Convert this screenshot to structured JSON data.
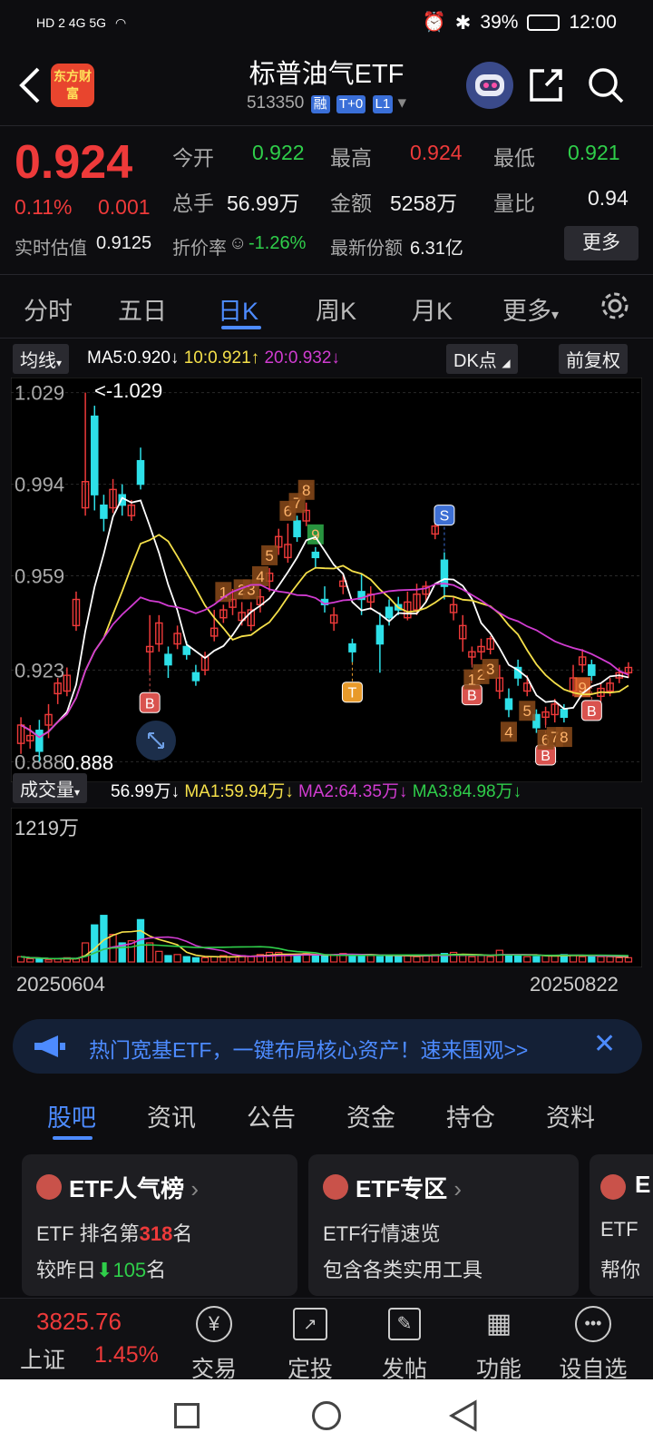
{
  "status": {
    "net": "HD 2 4G 5G",
    "battery": "39%",
    "time": "12:00"
  },
  "header": {
    "logo": "东方财富",
    "title": "标普油气ETF",
    "code": "513350",
    "tags": [
      "融",
      "T+0",
      "L1"
    ]
  },
  "quote": {
    "price": "0.924",
    "pct": "0.11%",
    "chg": "0.001",
    "open_label": "今开",
    "open": "0.922",
    "high_label": "最高",
    "high": "0.924",
    "low_label": "最低",
    "low": "0.921",
    "vol_label": "总手",
    "vol": "56.99万",
    "amt_label": "金额",
    "amt": "5258万",
    "ratio_label": "量比",
    "ratio": "0.94",
    "est_label": "实时估值",
    "est": "0.9125",
    "discount_label": "折价率",
    "discount": "-1.26%",
    "shares_label": "最新份额",
    "shares": "6.31亿",
    "more": "更多"
  },
  "tabs": [
    "分时",
    "五日",
    "日K",
    "周K",
    "月K",
    "更多"
  ],
  "active_tab": "日K",
  "kline": {
    "ma_mode": "均线",
    "ma5": "MA5:0.920",
    "ma10": "10:0.921",
    "ma20": "20:0.932",
    "dk": "DK点",
    "adjust": "前复权",
    "max_marker": "<-1.029",
    "min_marker": "0.888",
    "vol_mode": "成交量",
    "vol_now": "56.99万",
    "ma1": "MA1:59.94万",
    "ma2": "MA2:64.35万",
    "ma3": "MA3:84.98万",
    "vol_max": "1219万",
    "date_start": "20250604",
    "date_end": "20250822"
  },
  "chart_data": {
    "type": "candlestick",
    "price_axis": [
      1.029,
      0.994,
      0.959,
      0.923,
      0.888
    ],
    "ylim": [
      0.885,
      1.032
    ],
    "candles": [
      [
        0.895,
        0.902,
        0.905,
        0.891
      ],
      [
        0.896,
        0.898,
        0.902,
        0.893
      ],
      [
        0.9,
        0.892,
        0.904,
        0.888
      ],
      [
        0.902,
        0.906,
        0.91,
        0.897
      ],
      [
        0.914,
        0.918,
        0.92,
        0.91
      ],
      [
        0.915,
        0.921,
        0.924,
        0.913
      ],
      [
        0.94,
        0.95,
        0.953,
        0.938
      ],
      [
        0.985,
        0.995,
        1.029,
        0.982
      ],
      [
        1.02,
        0.99,
        1.024,
        0.984
      ],
      [
        0.986,
        0.981,
        0.99,
        0.976
      ],
      [
        0.985,
        0.992,
        0.996,
        0.983
      ],
      [
        0.99,
        0.986,
        0.994,
        0.982
      ],
      [
        0.982,
        0.986,
        0.988,
        0.98
      ],
      [
        1.003,
        0.994,
        1.008,
        0.992
      ],
      [
        0.93,
        0.932,
        0.944,
        0.922
      ],
      [
        0.933,
        0.941,
        0.944,
        0.93
      ],
      [
        0.929,
        0.925,
        0.932,
        0.92
      ],
      [
        0.933,
        0.937,
        0.94,
        0.931
      ],
      [
        0.932,
        0.929,
        0.934,
        0.927
      ],
      [
        0.922,
        0.919,
        0.925,
        0.917
      ],
      [
        0.923,
        0.928,
        0.93,
        0.921
      ],
      [
        0.936,
        0.939,
        0.946,
        0.934
      ],
      [
        0.943,
        0.946,
        0.948,
        0.941
      ],
      [
        0.947,
        0.95,
        0.954,
        0.944
      ],
      [
        0.942,
        0.945,
        0.949,
        0.94
      ],
      [
        0.94,
        0.946,
        0.949,
        0.938
      ],
      [
        0.948,
        0.951,
        0.954,
        0.945
      ],
      [
        0.957,
        0.96,
        0.962,
        0.953
      ],
      [
        0.97,
        0.974,
        0.977,
        0.967
      ],
      [
        0.966,
        0.971,
        0.979,
        0.964
      ],
      [
        0.98,
        0.974,
        0.982,
        0.972
      ],
      [
        0.98,
        0.984,
        0.987,
        0.978
      ],
      [
        0.968,
        0.966,
        0.97,
        0.962
      ],
      [
        0.95,
        0.948,
        0.955,
        0.945
      ],
      [
        0.941,
        0.944,
        0.947,
        0.938
      ],
      [
        0.955,
        0.957,
        0.96,
        0.952
      ],
      [
        0.933,
        0.93,
        0.935,
        0.926
      ],
      [
        0.953,
        0.95,
        0.96,
        0.944
      ],
      [
        0.949,
        0.952,
        0.955,
        0.946
      ],
      [
        0.94,
        0.933,
        0.945,
        0.922
      ],
      [
        0.947,
        0.943,
        0.95,
        0.94
      ],
      [
        0.948,
        0.946,
        0.951,
        0.944
      ],
      [
        0.943,
        0.949,
        0.953,
        0.942
      ],
      [
        0.946,
        0.952,
        0.956,
        0.944
      ],
      [
        0.952,
        0.955,
        0.957,
        0.949
      ],
      [
        0.975,
        0.978,
        0.981,
        0.973
      ],
      [
        0.965,
        0.955,
        0.968,
        0.95
      ],
      [
        0.945,
        0.948,
        0.951,
        0.942
      ],
      [
        0.935,
        0.94,
        0.944,
        0.93
      ],
      [
        0.928,
        0.93,
        0.932,
        0.925
      ],
      [
        0.93,
        0.932,
        0.935,
        0.927
      ],
      [
        0.931,
        0.935,
        0.936,
        0.929
      ],
      [
        0.915,
        0.92,
        0.925,
        0.912
      ],
      [
        0.912,
        0.908,
        0.916,
        0.905
      ],
      [
        0.924,
        0.92,
        0.927,
        0.917
      ],
      [
        0.915,
        0.918,
        0.921,
        0.913
      ],
      [
        0.906,
        0.901,
        0.908,
        0.899
      ],
      [
        0.905,
        0.907,
        0.909,
        0.902
      ],
      [
        0.906,
        0.91,
        0.912,
        0.903
      ],
      [
        0.908,
        0.905,
        0.91,
        0.903
      ],
      [
        0.915,
        0.92,
        0.925,
        0.913
      ],
      [
        0.925,
        0.928,
        0.931,
        0.922
      ],
      [
        0.925,
        0.921,
        0.927,
        0.919
      ],
      [
        0.913,
        0.916,
        0.918,
        0.911
      ],
      [
        0.915,
        0.918,
        0.92,
        0.913
      ],
      [
        0.92,
        0.922,
        0.924,
        0.918
      ],
      [
        0.922,
        0.924,
        0.926,
        0.92
      ]
    ],
    "dk_labels": [
      "B",
      "B",
      "T",
      "S",
      "B",
      "B"
    ],
    "seq_labels": [
      "1",
      "2",
      "3",
      "4",
      "5",
      "6",
      "7",
      "8",
      "9",
      "1",
      "2",
      "3",
      "4",
      "5",
      "6",
      "7",
      "8",
      "9"
    ],
    "volumes": [
      5,
      3,
      3,
      2,
      3,
      4,
      3,
      18,
      35,
      44,
      26,
      18,
      20,
      40,
      18,
      10,
      6,
      7,
      5,
      4,
      4,
      5,
      6,
      5,
      6,
      5,
      7,
      9,
      9,
      6,
      6,
      8,
      6,
      6,
      7,
      8,
      7,
      7,
      6,
      5,
      6,
      6,
      6,
      5,
      6,
      7,
      8,
      9,
      6,
      5,
      6,
      5,
      11,
      7,
      6,
      5,
      5,
      6,
      6,
      7,
      6,
      5,
      6,
      5,
      5,
      4,
      4
    ],
    "vol_ylim": [
      0,
      120
    ]
  },
  "banner": {
    "text": "热门宽基ETF，一键布局核心资产！速来围观>>"
  },
  "bottom_tabs": [
    "股吧",
    "资讯",
    "公告",
    "资金",
    "持仓",
    "资料"
  ],
  "active_bottom_tab": "股吧",
  "cards": [
    {
      "title": "ETF人气榜",
      "line1a": "ETF 排名第",
      "line1b": "318",
      "line1c": "名",
      "line2a": "较昨日",
      "line2b": "105",
      "line2c": "名"
    },
    {
      "title": "ETF专区",
      "line1a": "ETF行情速览",
      "line2a": "包含各类实用工具"
    },
    {
      "title": "E",
      "line1a": "ETF",
      "line2a": "帮你"
    }
  ],
  "bottom_nav": {
    "index_value": "3825.76",
    "index_name": "上证",
    "index_pct": "1.45%",
    "items": [
      "交易",
      "定投",
      "发帖",
      "功能",
      "设自选"
    ]
  }
}
